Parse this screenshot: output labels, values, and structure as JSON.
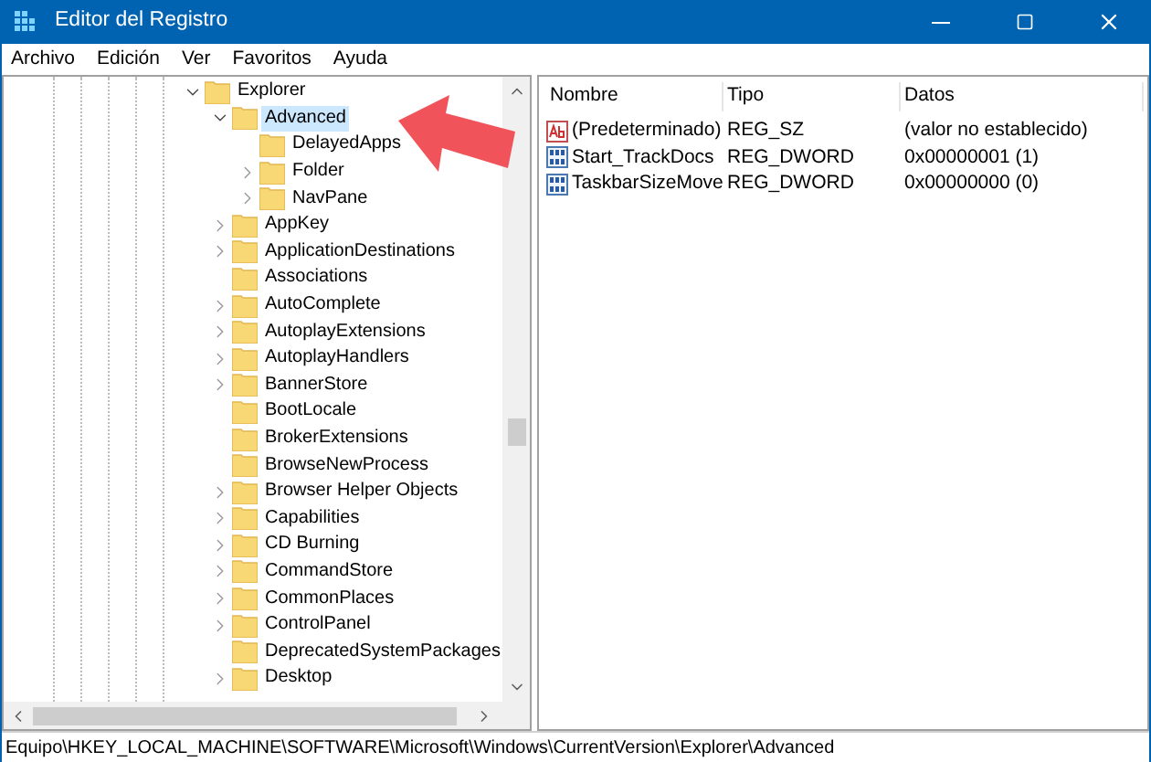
{
  "window": {
    "title": "Editor del Registro"
  },
  "menu": [
    "Archivo",
    "Edición",
    "Ver",
    "Favoritos",
    "Ayuda"
  ],
  "tree": [
    {
      "label": "Explorer",
      "expanded": true,
      "selected": false,
      "children": [
        {
          "label": "Advanced",
          "expanded": true,
          "selected": true,
          "children": [
            {
              "label": "DelayedApps",
              "selected": false
            },
            {
              "label": "Folder",
              "expanded": false,
              "selected": false
            },
            {
              "label": "NavPane",
              "expanded": false,
              "selected": false
            }
          ]
        },
        {
          "label": "AppKey",
          "expanded": false,
          "selected": false
        },
        {
          "label": "ApplicationDestinations",
          "expanded": false,
          "selected": false
        },
        {
          "label": "Associations",
          "selected": false
        },
        {
          "label": "AutoComplete",
          "expanded": false,
          "selected": false
        },
        {
          "label": "AutoplayExtensions",
          "expanded": false,
          "selected": false
        },
        {
          "label": "AutoplayHandlers",
          "expanded": false,
          "selected": false
        },
        {
          "label": "BannerStore",
          "expanded": false,
          "selected": false
        },
        {
          "label": "BootLocale",
          "selected": false
        },
        {
          "label": "BrokerExtensions",
          "selected": false
        },
        {
          "label": "BrowseNewProcess",
          "selected": false
        },
        {
          "label": "Browser Helper Objects",
          "expanded": false,
          "selected": false
        },
        {
          "label": "Capabilities",
          "expanded": false,
          "selected": false
        },
        {
          "label": "CD Burning",
          "expanded": false,
          "selected": false
        },
        {
          "label": "CommandStore",
          "expanded": false,
          "selected": false
        },
        {
          "label": "CommonPlaces",
          "expanded": false,
          "selected": false
        },
        {
          "label": "ControlPanel",
          "expanded": false,
          "selected": false
        },
        {
          "label": "DeprecatedSystemPackages",
          "selected": false
        },
        {
          "label": "Desktop",
          "expanded": false,
          "selected": false
        }
      ]
    }
  ],
  "values": {
    "columns": [
      "Nombre",
      "Tipo",
      "Datos"
    ],
    "rows": [
      {
        "kind": "string",
        "name": "(Predeterminado)",
        "type": "REG_SZ",
        "data": "(valor no establecido)"
      },
      {
        "kind": "binary",
        "name": "Start_TrackDocs",
        "type": "REG_DWORD",
        "data": "0x00000001 (1)"
      },
      {
        "kind": "binary",
        "name": "TaskbarSizeMove",
        "type": "REG_DWORD",
        "data": "0x00000000 (0)"
      }
    ]
  },
  "status_bar": "Equipo\\HKEY_LOCAL_MACHINE\\SOFTWARE\\Microsoft\\Windows\\CurrentVersion\\Explorer\\Advanced"
}
